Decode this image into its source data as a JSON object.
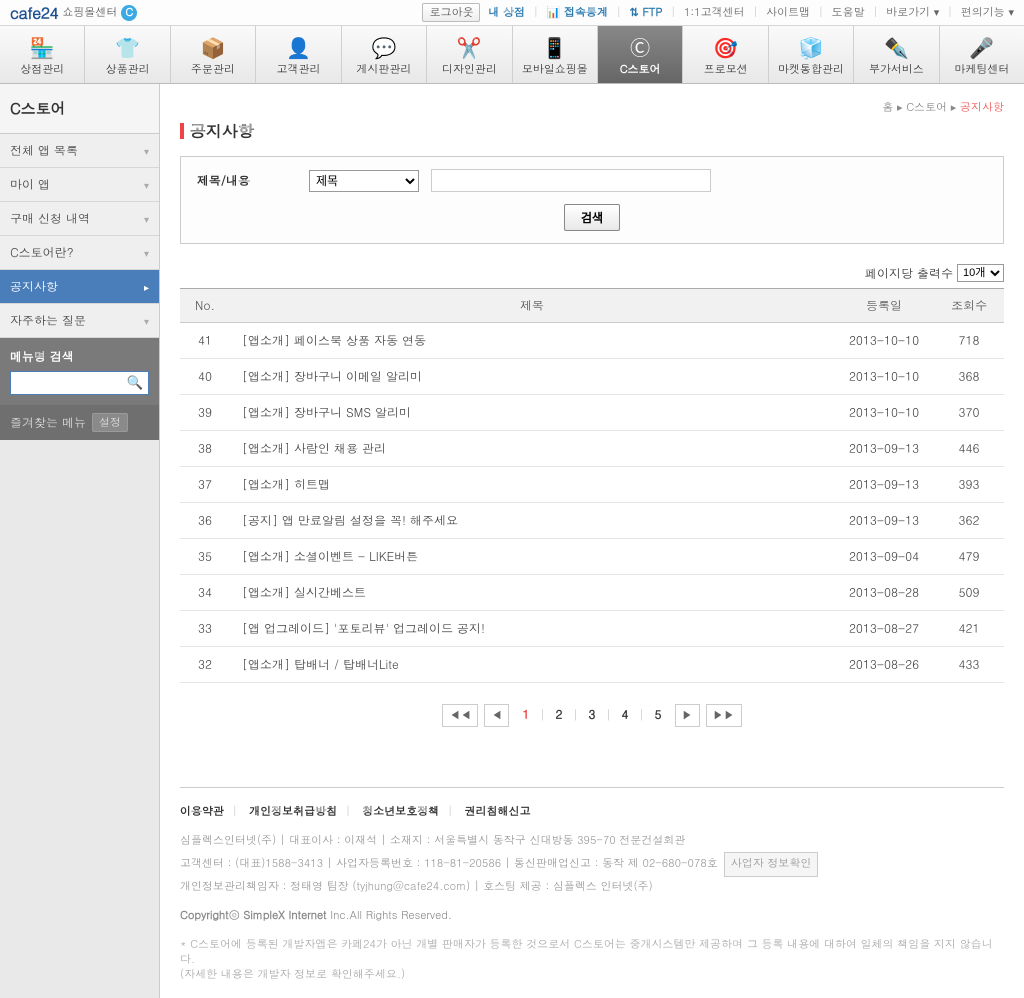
{
  "logo": {
    "brand": "cafe24",
    "sub": "쇼핑몰센터",
    "badge": "C"
  },
  "topbar": {
    "logout": "로그아웃",
    "my_shop": "내 상점",
    "stats": "접속통계",
    "ftp": "FTP",
    "cs": "1:1고객센터",
    "sitemap": "사이트맵",
    "help": "도움말",
    "shortcut": "바로가기",
    "extra": "편의기능"
  },
  "nav": [
    {
      "label": "상점관리"
    },
    {
      "label": "상품관리"
    },
    {
      "label": "주문관리"
    },
    {
      "label": "고객관리"
    },
    {
      "label": "게시판관리"
    },
    {
      "label": "디자인관리"
    },
    {
      "label": "모바일쇼핑몰"
    },
    {
      "label": "C스토어"
    },
    {
      "label": "프로모션"
    },
    {
      "label": "마켓통합관리"
    },
    {
      "label": "부가서비스"
    },
    {
      "label": "마케팅센터"
    }
  ],
  "sidebar": {
    "title": "C스토어",
    "items": [
      {
        "label": "전체 앱 목록"
      },
      {
        "label": "마이 앱"
      },
      {
        "label": "구매 신청 내역"
      },
      {
        "label": "C스토어란?"
      },
      {
        "label": "공지사항"
      },
      {
        "label": "자주하는 질문"
      }
    ],
    "search_label": "메뉴명 검색",
    "search_placeholder": "",
    "fav_label": "즐겨찾는 메뉴",
    "fav_set": "설정"
  },
  "breadcrumb": {
    "home": "홈",
    "mid": "C스토어",
    "cur": "공지사항"
  },
  "page_title": "공지사항",
  "search": {
    "field_label": "제목/내용",
    "select_value": "제목",
    "input_value": "",
    "btn": "검색"
  },
  "list": {
    "per_page_label": "페이지당 출력수",
    "per_page_value": "10개",
    "cols": {
      "no": "No.",
      "title": "제목",
      "date": "등록일",
      "views": "조회수"
    },
    "rows": [
      {
        "no": "41",
        "title": "[앱소개] 페이스북 상품 자동 연동",
        "date": "2013-10-10",
        "views": "718"
      },
      {
        "no": "40",
        "title": "[앱소개] 장바구니 이메일 알리미",
        "date": "2013-10-10",
        "views": "368"
      },
      {
        "no": "39",
        "title": "[앱소개] 장바구니 SMS 알리미",
        "date": "2013-10-10",
        "views": "370"
      },
      {
        "no": "38",
        "title": "[앱소개] 사람인 채용 관리",
        "date": "2013-09-13",
        "views": "446"
      },
      {
        "no": "37",
        "title": "[앱소개] 히트맵",
        "date": "2013-09-13",
        "views": "393"
      },
      {
        "no": "36",
        "title": "[공지] 앱 만료알림 설정을 꼭! 해주세요",
        "date": "2013-09-13",
        "views": "362"
      },
      {
        "no": "35",
        "title": "[앱소개] 소셜이벤트 - LIKE버튼",
        "date": "2013-09-04",
        "views": "479"
      },
      {
        "no": "34",
        "title": "[앱소개] 실시간베스트",
        "date": "2013-08-28",
        "views": "509"
      },
      {
        "no": "33",
        "title": "[앱 업그레이드] '포토리뷰' 업그레이드 공지!",
        "date": "2013-08-27",
        "views": "421"
      },
      {
        "no": "32",
        "title": "[앱소개] 탑배너 / 탑배너Lite",
        "date": "2013-08-26",
        "views": "433"
      }
    ]
  },
  "pagination": {
    "pages": [
      "1",
      "2",
      "3",
      "4",
      "5"
    ],
    "active": "1"
  },
  "footer": {
    "links": [
      "이용약관",
      "개인정보취급방침",
      "청소년보호정책",
      "권리침해신고"
    ],
    "info1": "심플렉스인터넷(주)  |  대표이사 : 이재석  |  소재지 : 서울특별시 동작구 신대방동 395-70 전문건설회관",
    "info2_a": "고객센터 : (대표)1588-3413  |  사업자등록번호 : 118-81-20586  |  통신판매업신고 : 동작 제 02-680-078호",
    "biz_btn": "사업자 정보확인",
    "info3": "개인정보관리책임자 : 정태영 팀장 (tyjhung@cafe24.com)  |  호스팅 제공 : 심플렉스 인터넷(주)",
    "copyright": "Copyrightⓒ SimpleX Internet Inc.All Rights Reserved.",
    "note1": "* C스토어에 등록된 개발자앱은 카페24가 아닌 개별 판매자가 등록한 것으로서 C스토어는 중개시스템만 제공하며 그 등록 내용에 대하여 일체의 책임을 지지 않습니다.",
    "note2": "(자세한 내용은 개발자 정보로 확인해주세요.)"
  }
}
